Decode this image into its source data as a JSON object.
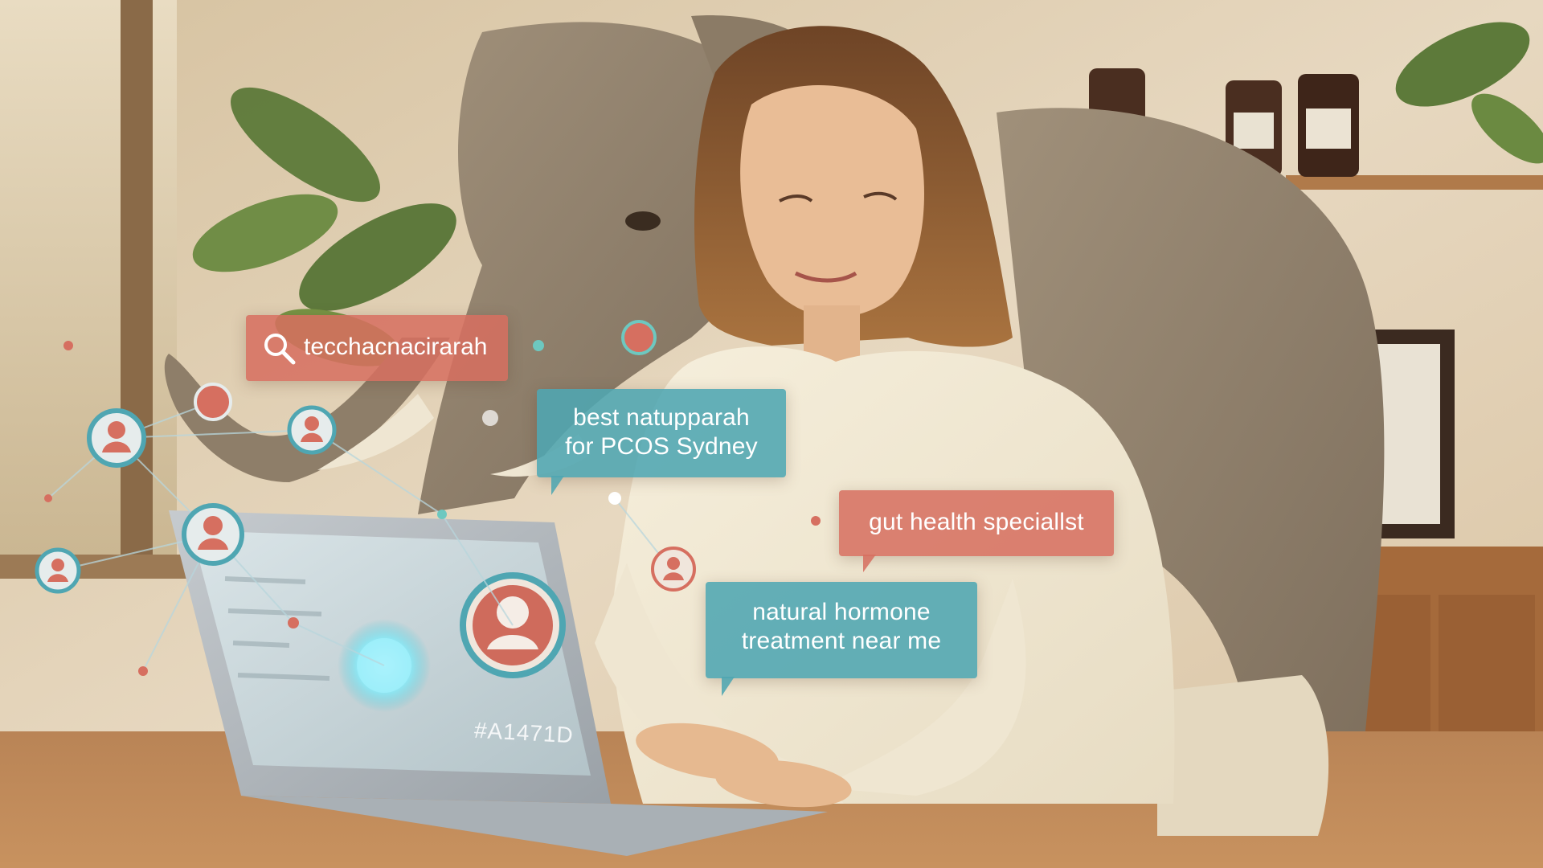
{
  "search": {
    "query": "tecchacnacirarah",
    "icon": "search-icon"
  },
  "bubbles": {
    "best": {
      "line1": "best natupparah",
      "line2": "for PCOS Sydney"
    },
    "gut": {
      "text": "gut health speciallst"
    },
    "natural": {
      "line1": "natural hormone",
      "line2": "treatment near me"
    }
  },
  "laptop_screen": {
    "code": "#A1471D"
  },
  "colors": {
    "teal": "#4FA6B2",
    "coral": "#D66F60",
    "accent_bar": "#2BB8A0",
    "wall": "#E4D3B8",
    "wood": "#A26A3E"
  }
}
